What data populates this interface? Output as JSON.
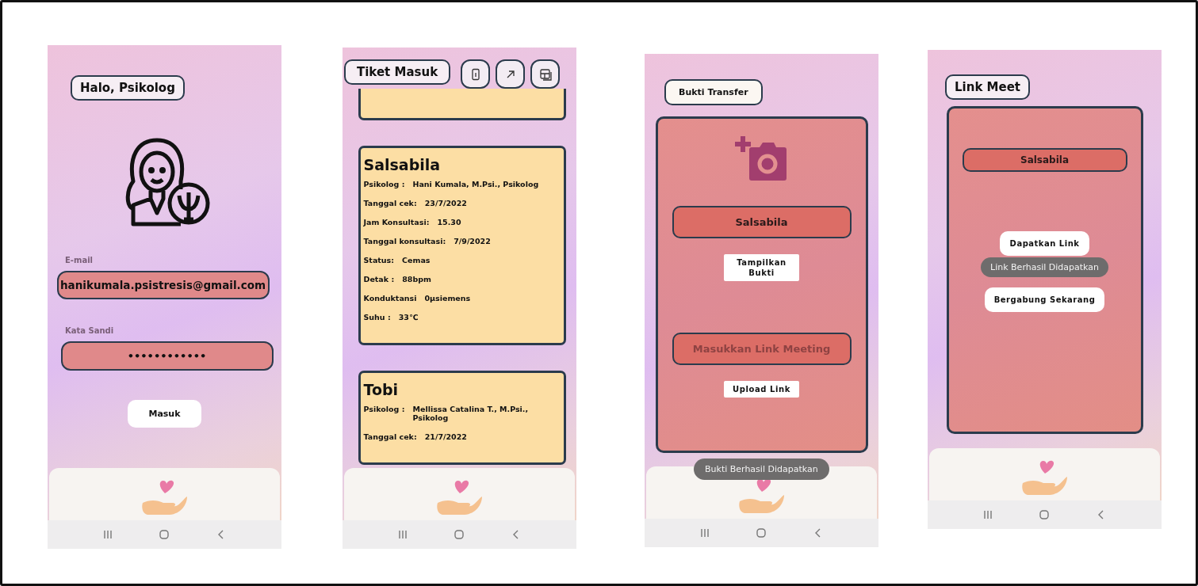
{
  "screens": [
    {
      "kind": "login",
      "title": "Halo, Psikolog",
      "fields": [
        {
          "label": "E-mail",
          "value": "hanikumala.psistresis@gmail.com"
        },
        {
          "label": "Kata Sandi",
          "value": "••••••••••••"
        }
      ],
      "button": "Masuk"
    },
    {
      "kind": "tickets",
      "title": "Tiket Masuk",
      "tickets": [
        {
          "name": "Salsabila",
          "rows": [
            {
              "label": "Psikolog :",
              "value": "Hani Kumala, M.Psi., Psikolog"
            },
            {
              "label": "Tanggal cek:",
              "value": "23/7/2022"
            },
            {
              "label": "Jam Konsultasi:",
              "value": "15.30"
            },
            {
              "label": "Tanggal konsultasi:",
              "value": "7/9/2022"
            },
            {
              "label": "Status:",
              "value": "Cemas"
            },
            {
              "label": "Detak :",
              "value": "88bpm"
            },
            {
              "label": "Konduktansi",
              "value": "0μsiemens"
            },
            {
              "label": "Suhu :",
              "value": "33℃"
            }
          ]
        },
        {
          "name": "Tobi",
          "rows": [
            {
              "label": "Psikolog :",
              "value": "Mellissa Catalina T., M.Psi., Psikolog"
            },
            {
              "label": "Tanggal cek:",
              "value": "21/7/2022"
            }
          ]
        }
      ]
    },
    {
      "kind": "transfer",
      "title": "Bukti Transfer",
      "name": "Salsabila",
      "show_button": "Tampilkan Bukti",
      "link_placeholder": "Masukkan Link Meeting",
      "upload_button": "Upload Link",
      "toast": "Bukti Berhasil Didapatkan"
    },
    {
      "kind": "meet",
      "title": "Link Meet",
      "name": "Salsabila",
      "get_button": "Dapatkan Link",
      "toast": "Link Berhasil Didapatkan",
      "join_button": "Bergabung Sekarang"
    }
  ]
}
